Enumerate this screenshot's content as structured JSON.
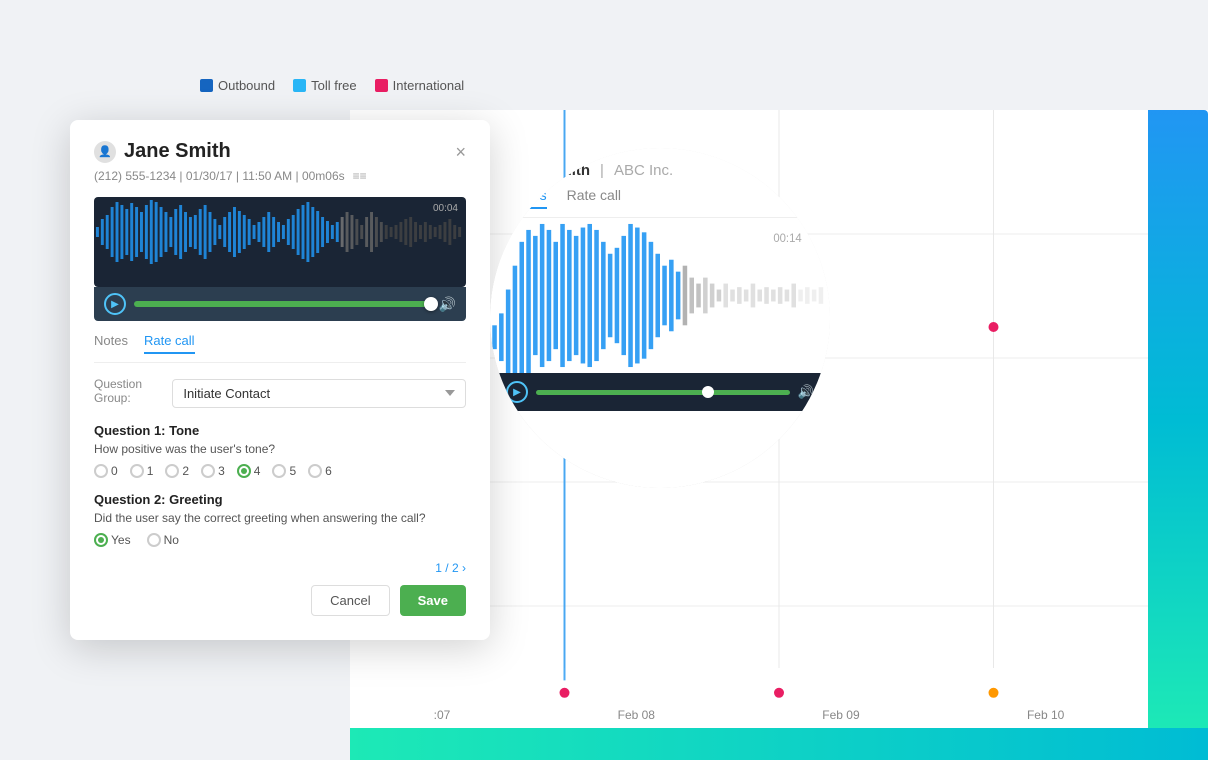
{
  "legend": {
    "items": [
      {
        "label": "Outbound",
        "color": "#1565C0"
      },
      {
        "label": "Toll free",
        "color": "#29B6F6"
      },
      {
        "label": "International",
        "color": "#E91E63"
      }
    ]
  },
  "dialog": {
    "title": "Jane Smith",
    "close_label": "×",
    "meta": "(212) 555-1234 | 01/30/17 | 11:50 AM | 00m06s",
    "waveform_time": "00:04",
    "tabs": [
      {
        "label": "Notes",
        "active": false
      },
      {
        "label": "Rate call",
        "active": true
      }
    ],
    "form": {
      "question_group_label": "Question Group:",
      "question_group_value": "Initiate Contact",
      "question1_title": "Question 1: Tone",
      "question1_text": "How positive was the user's tone?",
      "rating_options": [
        "0",
        "1",
        "2",
        "3",
        "4",
        "5",
        "6"
      ],
      "selected_rating": "4",
      "question2_title": "Question 2: Greeting",
      "question2_text": "Did the user say the correct greeting when answering the call?",
      "yes_no_options": [
        "Yes",
        "No"
      ],
      "selected_answer": "Yes"
    },
    "pagination": "1 / 2",
    "cancel_label": "Cancel",
    "save_label": "Save"
  },
  "bubble": {
    "name": "Jane Smith",
    "company": "ABC Inc.",
    "tabs": [
      {
        "label": "Notes",
        "active": true
      },
      {
        "label": "Rate call",
        "active": false
      }
    ],
    "waveform_time": "00:14"
  },
  "chart": {
    "dates": [
      ":07",
      "Feb 08",
      "Feb 09",
      "Feb 10"
    ]
  }
}
